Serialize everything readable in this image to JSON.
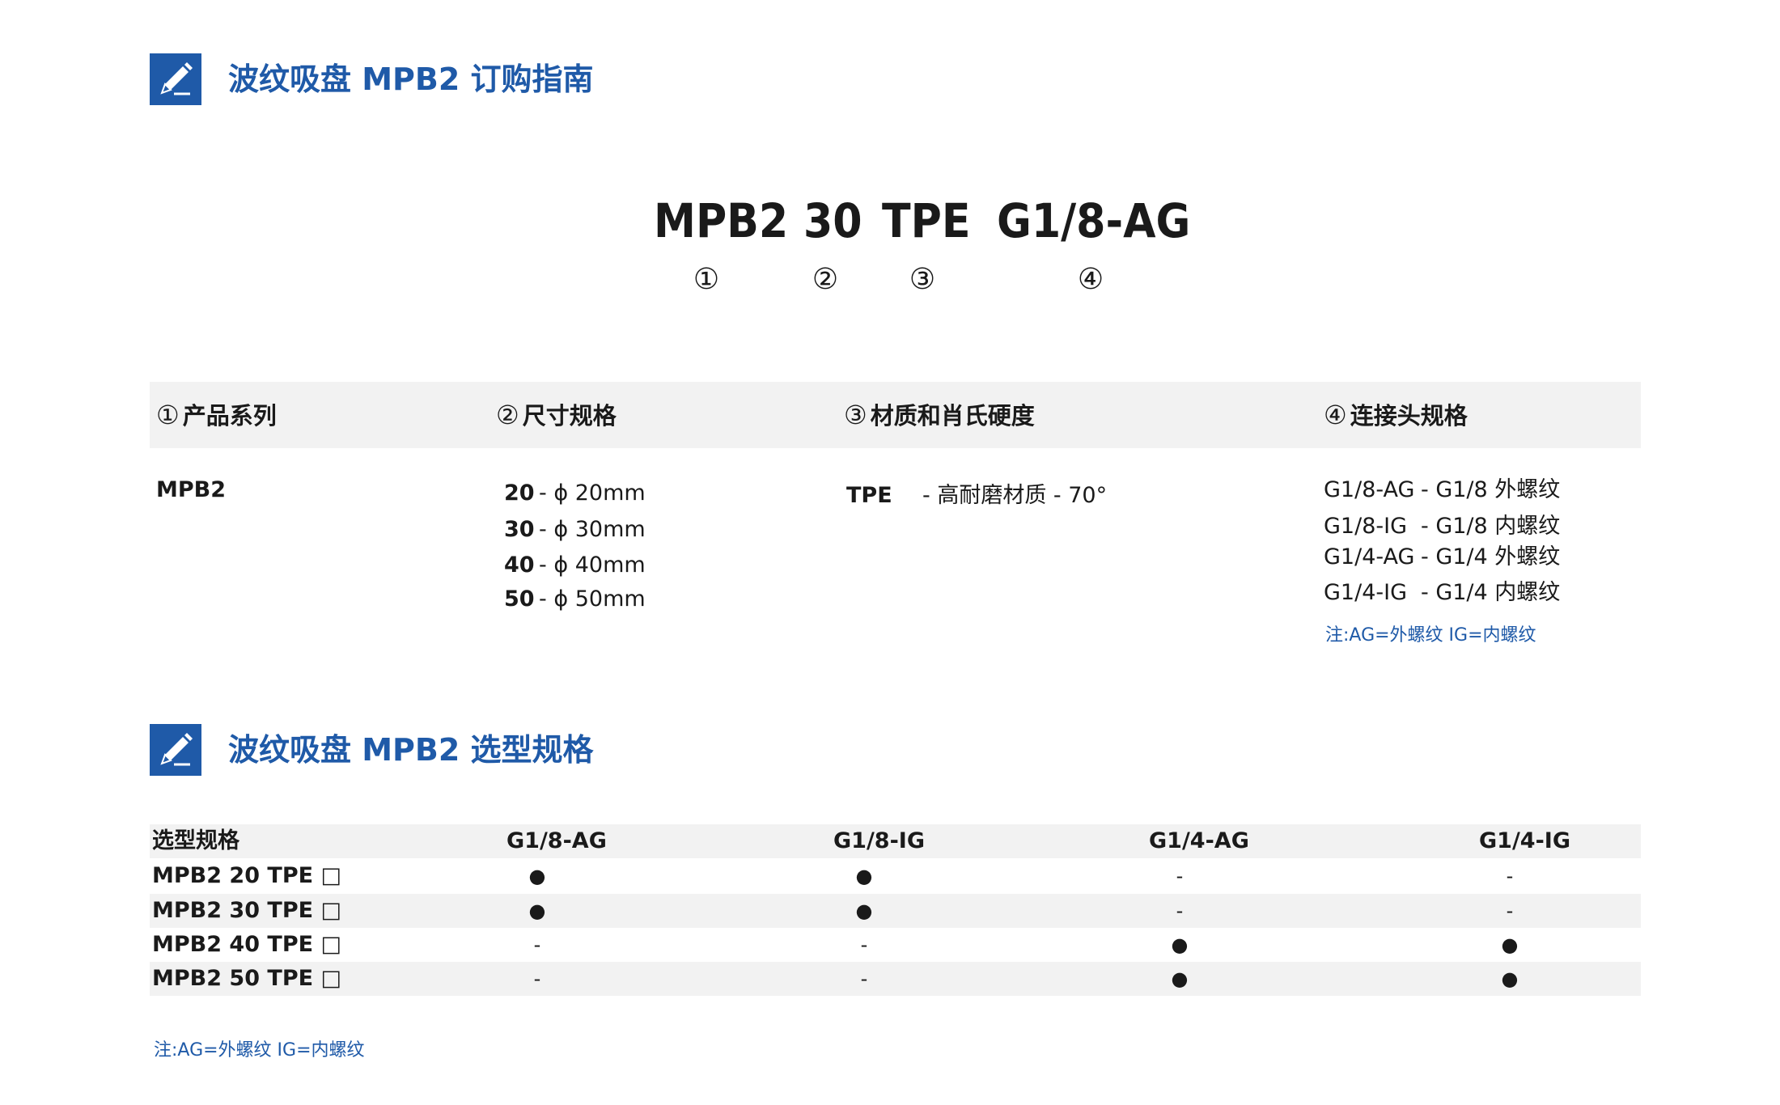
{
  "section1": {
    "title": "波纹吸盘 MPB2 订购指南",
    "icon": "pencil-icon"
  },
  "code": {
    "parts": [
      "MPB2",
      "30",
      "TPE",
      "G1/8-AG"
    ],
    "markers": [
      "①",
      "②",
      "③",
      "④"
    ]
  },
  "spec": {
    "headers": [
      {
        "num": "①",
        "label": "产品系列"
      },
      {
        "num": "②",
        "label": "尺寸规格"
      },
      {
        "num": "③",
        "label": "材质和肖氏硬度"
      },
      {
        "num": "④",
        "label": "连接头规格"
      }
    ],
    "series": "MPB2",
    "sizes": [
      {
        "code": "20",
        "desc": "- ϕ 20mm"
      },
      {
        "code": "30",
        "desc": "- ϕ 30mm"
      },
      {
        "code": "40",
        "desc": "- ϕ 40mm"
      },
      {
        "code": "50",
        "desc": "- ϕ 50mm"
      }
    ],
    "material": {
      "code": "TPE",
      "desc": "-  高耐磨材质  -  70°"
    },
    "connectors": [
      {
        "code": "G1/8-AG",
        "desc": "-  G1/8 外螺纹"
      },
      {
        "code": "G1/8-IG",
        "desc": "-  G1/8 内螺纹"
      },
      {
        "code": "G1/4-AG",
        "desc": "-  G1/4 外螺纹"
      },
      {
        "code": "G1/4-IG",
        "desc": "-  G1/4 内螺纹"
      }
    ],
    "note": "注:AG=外螺纹    IG=内螺纹"
  },
  "section2": {
    "title": "波纹吸盘 MPB2 选型规格",
    "icon": "pencil-icon"
  },
  "selection": {
    "header": [
      "选型规格",
      "G1/8-AG",
      "G1/8-IG",
      "G1/4-AG",
      "G1/4-IG"
    ],
    "rows": [
      {
        "label": "MPB2  20 TPE □",
        "cells": [
          "●",
          "●",
          "-",
          "-"
        ]
      },
      {
        "label": "MPB2  30 TPE □",
        "cells": [
          "●",
          "●",
          "-",
          "-"
        ]
      },
      {
        "label": "MPB2  40 TPE □",
        "cells": [
          "-",
          "-",
          "●",
          "●"
        ]
      },
      {
        "label": "MPB2  50 TPE □",
        "cells": [
          "-",
          "-",
          "●",
          "●"
        ]
      }
    ],
    "note": "注:AG=外螺纹    IG=内螺纹"
  },
  "colors": {
    "accent": "#1f5aa8",
    "band": "#f2f2f2",
    "text": "#1a1a1a"
  }
}
